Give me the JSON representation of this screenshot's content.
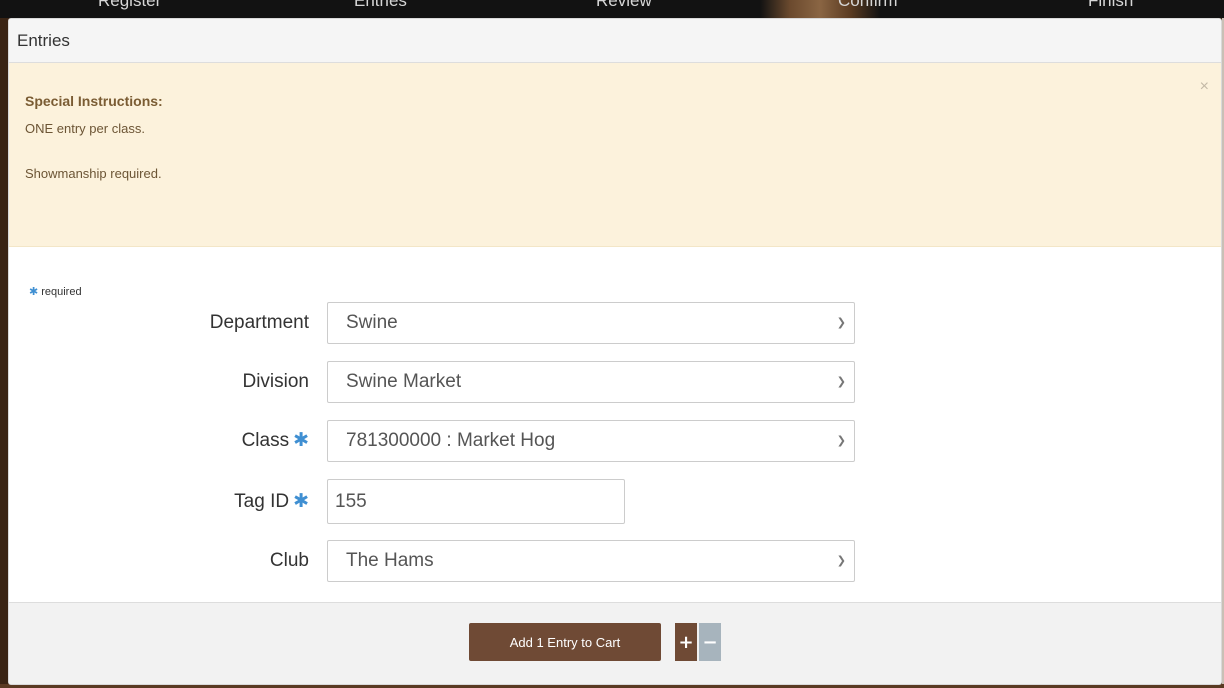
{
  "wizard_steps": [
    "Register",
    "Entries",
    "Review",
    "Confirm",
    "Finish"
  ],
  "panel": {
    "title": "Entries"
  },
  "instructions": {
    "title": "Special Instructions:",
    "lines": [
      "ONE entry per class.",
      "Showmanship required."
    ],
    "close_glyph": "×"
  },
  "form": {
    "required_note": "required",
    "department": {
      "label": "Department",
      "value": "Swine"
    },
    "division": {
      "label": "Division",
      "value": "Swine Market"
    },
    "class": {
      "label": "Class",
      "value": "781300000 : Market Hog"
    },
    "tag_id": {
      "label": "Tag ID",
      "value": "155"
    },
    "club": {
      "label": "Club",
      "value": "The Hams"
    }
  },
  "actions": {
    "add_label": "Add 1 Entry to Cart",
    "plus_glyph": "+",
    "minus_glyph": "−"
  },
  "colors": {
    "brand_button": "#6f4a35",
    "minus_button": "#a7b4bd",
    "alert_bg": "#fcf2dc",
    "required_asterisk": "#3f8fd2"
  }
}
